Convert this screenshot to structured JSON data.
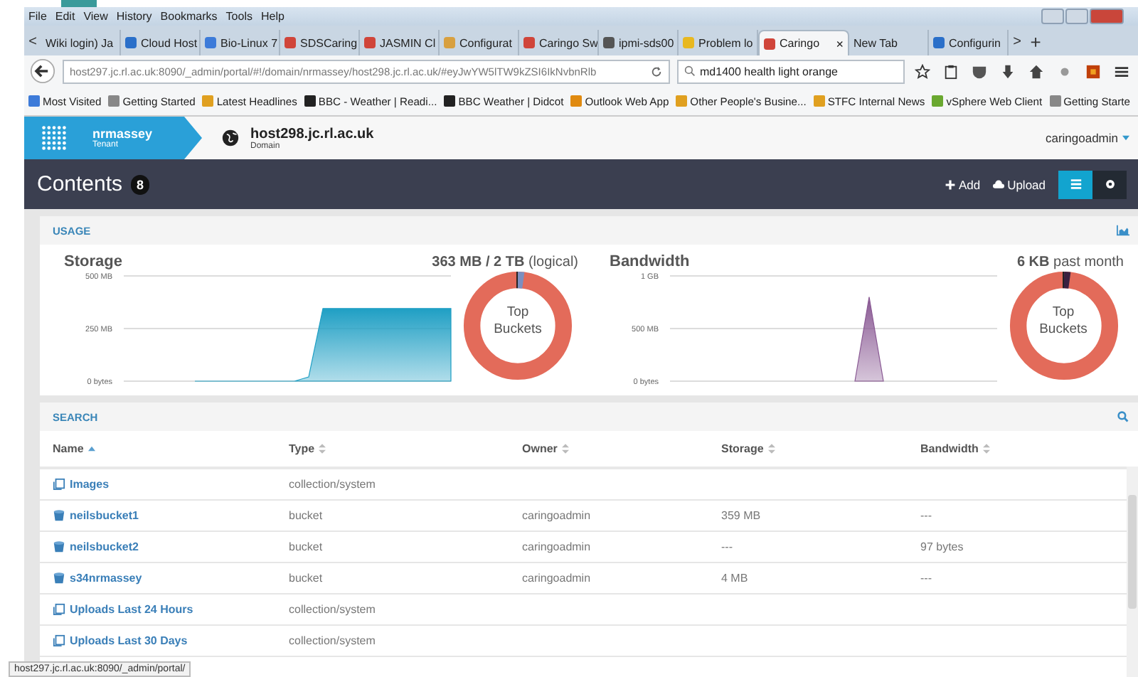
{
  "menu": [
    "File",
    "Edit",
    "View",
    "History",
    "Bookmarks",
    "Tools",
    "Help"
  ],
  "tabs": [
    {
      "label": "Wiki login) Ja",
      "selected": false
    },
    {
      "label": "Cloud Host",
      "selected": false,
      "color": "#2a6fc9"
    },
    {
      "label": "Bio-Linux 7",
      "selected": false,
      "color": "#3d7bd9"
    },
    {
      "label": "SDSCaring",
      "selected": false,
      "color": "#d0453a"
    },
    {
      "label": "JASMIN Cl",
      "selected": false,
      "color": "#d0453a"
    },
    {
      "label": "Configurat",
      "selected": false,
      "color": "#d8a040"
    },
    {
      "label": "Caringo Sw",
      "selected": false,
      "color": "#d0453a"
    },
    {
      "label": "ipmi-sds00",
      "selected": false,
      "color": "#555555"
    },
    {
      "label": "Problem lo",
      "selected": false,
      "color": "#e8b820"
    },
    {
      "label": "Caringo",
      "selected": true,
      "color": "#d0453a"
    },
    {
      "label": "New Tab",
      "selected": false
    },
    {
      "label": "Configurin",
      "selected": false,
      "color": "#2a6fc9"
    }
  ],
  "tab_close": "×",
  "tab_scroll_left": "<",
  "tab_scroll_right": ">",
  "tab_new": "+",
  "address": {
    "value": "host297.jc.rl.ac.uk:8090/_admin/portal/#!/domain/nrmassey/host298.jc.rl.ac.uk/#eyJwYW5lTW9kZSI6IkNvbnRlb"
  },
  "search": {
    "value": "md1400 health light orange"
  },
  "bookmarks": [
    {
      "label": "Most Visited",
      "color": "#3d7bd9"
    },
    {
      "label": "Getting Started",
      "color": "#888888"
    },
    {
      "label": "Latest Headlines",
      "color": "#e0a020"
    },
    {
      "label": "BBC - Weather | Readi...",
      "color": "#222222"
    },
    {
      "label": "BBC Weather | Didcot",
      "color": "#222222"
    },
    {
      "label": "Outlook Web App",
      "color": "#e08a10"
    },
    {
      "label": "Other People's Busine...",
      "color": "#e0a020"
    },
    {
      "label": "STFC Internal News",
      "color": "#e0a020"
    },
    {
      "label": "vSphere Web Client",
      "color": "#6aa830"
    },
    {
      "label": "Getting Starte",
      "color": "#888888"
    }
  ],
  "app_header": {
    "tenant": "nrmassey",
    "tenant_caption": "Tenant",
    "domain": "host298.jc.rl.ac.uk",
    "domain_caption": "Domain",
    "user": "caringoadmin"
  },
  "toolbar": {
    "title": "Contents",
    "count": "8",
    "add": "Add",
    "upload": "Upload",
    "views": [
      {
        "kind": "list",
        "selected": true
      },
      {
        "kind": "settings",
        "selected": false
      }
    ]
  },
  "usage": {
    "heading": "USAGE",
    "panels": [
      {
        "title": "Storage",
        "summary": "**363 MB / 2 TB** (logical)",
        "donut_label": "Top Buckets",
        "chart_data": {
          "type": "area",
          "values": [
            null,
            null,
            null,
            null,
            null,
            0,
            0,
            0,
            0,
            0,
            0,
            0,
            0,
            20,
            345,
            345,
            345,
            345,
            345,
            345,
            345,
            345,
            345,
            345
          ],
          "ylim": [
            0,
            500
          ],
          "yticks": [
            {
              "value": 0,
              "label": "0 bytes"
            },
            {
              "value": 250,
              "label": "250 MB"
            },
            {
              "value": 500,
              "label": "500 MB"
            }
          ]
        }
      },
      {
        "title": "Bandwidth",
        "summary": "**6 KB** past month",
        "donut_label": "Top Buckets",
        "top_tick": "1 GB",
        "chart_data": {
          "type": "area",
          "values": [
            null,
            null,
            null,
            null,
            null,
            null,
            null,
            null,
            null,
            null,
            null,
            null,
            null,
            0,
            800,
            0,
            null,
            null,
            null,
            null,
            null,
            null,
            null,
            null
          ],
          "ylim": [
            0,
            1000
          ],
          "yticks": [
            {
              "value": 0,
              "label": "0 bytes"
            },
            {
              "value": 500,
              "label": "500 MB"
            }
          ]
        }
      }
    ]
  },
  "search_panel": {
    "heading": "SEARCH",
    "columns": [
      {
        "label": "Name",
        "sorted": true
      },
      {
        "label": "Type",
        "sorted": false
      },
      {
        "label": "Owner",
        "sorted": false
      },
      {
        "label": "Storage",
        "sorted": false
      },
      {
        "label": "Bandwidth",
        "sorted": false
      }
    ],
    "rows": [
      {
        "kind": "collection",
        "name": "Images",
        "type": "collection/system"
      },
      {
        "kind": "bucket",
        "name": "neilsbucket1",
        "type": "bucket",
        "owner": "caringoadmin",
        "storage": "359 MB",
        "bandwidth": "---"
      },
      {
        "kind": "bucket",
        "name": "neilsbucket2",
        "type": "bucket",
        "owner": "caringoadmin",
        "storage": "---",
        "bandwidth": "97 bytes"
      },
      {
        "kind": "bucket",
        "name": "s34nrmassey",
        "type": "bucket",
        "owner": "caringoadmin",
        "storage": "4 MB",
        "bandwidth": "---"
      },
      {
        "kind": "collection",
        "name": "Uploads Last 24 Hours",
        "type": "collection/system"
      },
      {
        "kind": "collection",
        "name": "Uploads Last 30 Days",
        "type": "collection/system"
      }
    ]
  },
  "status_bar": "host297.jc.rl.ac.uk:8090/_admin/portal/"
}
